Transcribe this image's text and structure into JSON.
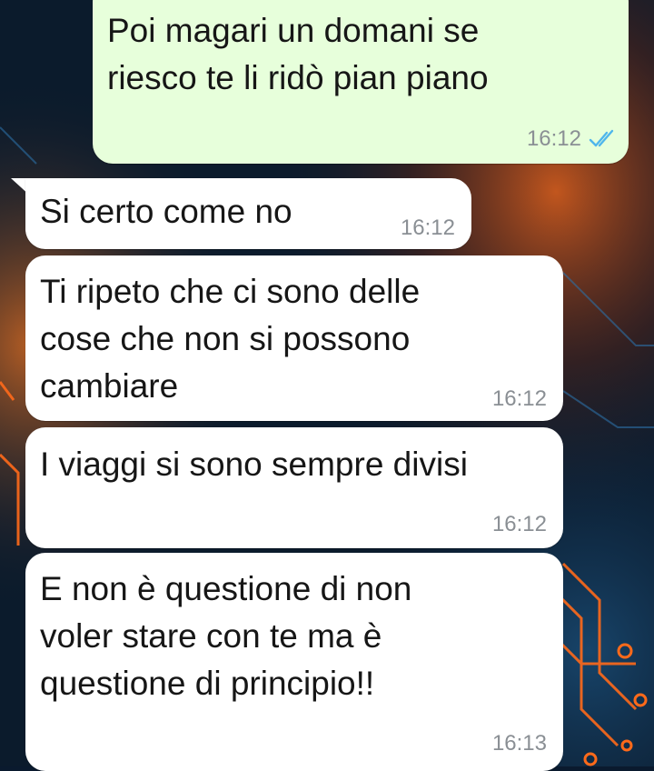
{
  "colors": {
    "outgoing_bubble": "#e7ffdb",
    "incoming_bubble": "#ffffff",
    "read_ticks": "#4fb6ec",
    "timestamp": "#8a8f94"
  },
  "messages": [
    {
      "direction": "outgoing",
      "text": "Poi magari un domani se\nriesco te li ridò pian piano",
      "time": "16:12",
      "status_icon": "double-check-read-icon"
    },
    {
      "direction": "incoming",
      "text": "Si certo come no",
      "time": "16:12"
    },
    {
      "direction": "incoming",
      "text": "Ti ripeto che ci sono delle\ncose che non si possono\ncambiare",
      "time": "16:12"
    },
    {
      "direction": "incoming",
      "text": "I viaggi si sono sempre divisi",
      "time": "16:12"
    },
    {
      "direction": "incoming",
      "text": "E non è questione di non\nvoler stare con te ma è\nquestione di principio!!",
      "time": "16:13"
    }
  ]
}
